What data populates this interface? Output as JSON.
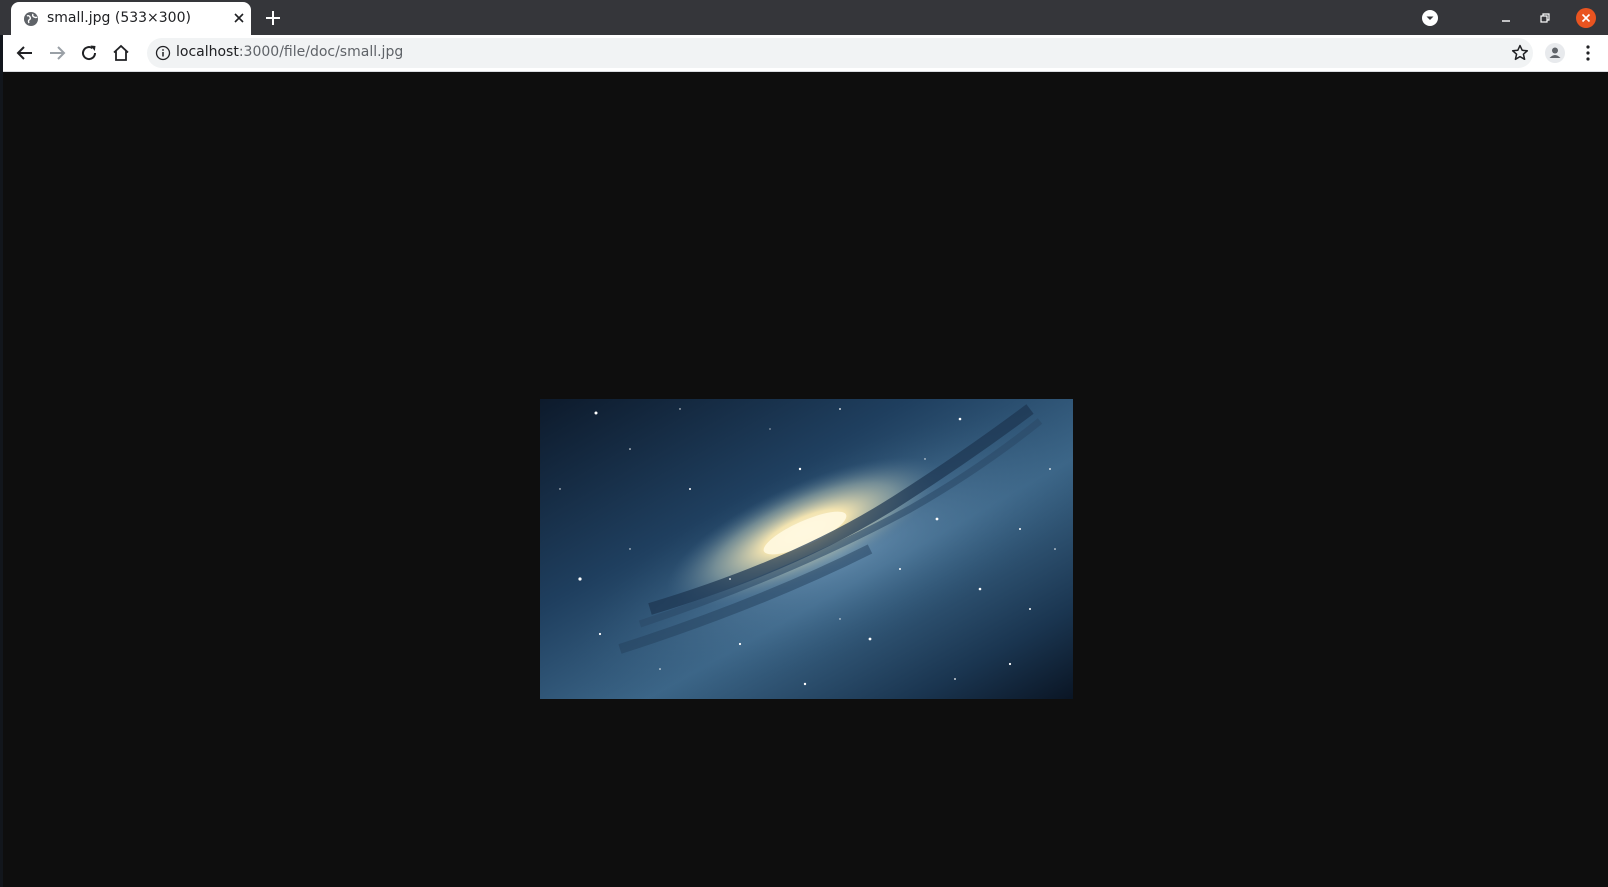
{
  "browser": {
    "tab": {
      "title": "small.jpg (533×300)",
      "favicon": "globe-icon"
    },
    "new_tab_icon": "plus-icon",
    "window_controls": [
      "tab-search-icon",
      "minimize-icon",
      "restore-icon",
      "close-window-icon"
    ],
    "address": {
      "host": "localhost",
      "path": ":3000/file/doc/small.jpg"
    },
    "toolbar_icons": [
      "back-arrow-icon",
      "forward-arrow-icon",
      "reload-icon",
      "home-icon",
      "info-icon",
      "star-icon",
      "profile-icon",
      "menu-kebab-icon"
    ],
    "colors": {
      "titlebar": "#35363a",
      "close_button": "#e95420",
      "page_background": "#0e0e0e"
    }
  },
  "content": {
    "image_name": "small.jpg",
    "image_description": "galaxy"
  }
}
